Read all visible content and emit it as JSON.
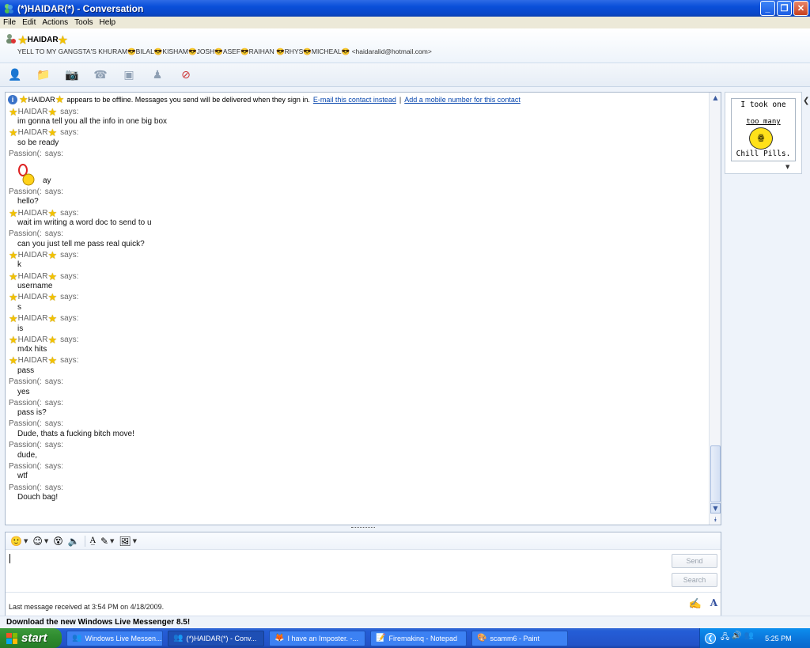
{
  "window": {
    "title": "(*)HAIDAR(*) - Conversation"
  },
  "menu": [
    "File",
    "Edit",
    "Actions",
    "Tools",
    "Help"
  ],
  "contact": {
    "name": "HAIDAR",
    "personal_message": "YELL TO MY GANGSTA'S KHURAM😎BILAL😎KISHAM😎JOSH😎ASEF😎RAIHAN 😎RHYS😎MICHEAL😎 <haidaralid@hotmail.com>"
  },
  "infobar": {
    "name": "HAIDAR",
    "text": "appears to be offline. Messages you send will be delivered when they sign in.",
    "link1": "E-mail this contact instead",
    "separator": "|",
    "link2": "Add a mobile number for this contact"
  },
  "says_label": "says:",
  "messages": [
    {
      "from": "HAIDAR",
      "star": true,
      "text": "im gonna tell you all the info in one big box"
    },
    {
      "from": "HAIDAR",
      "star": true,
      "text": "so be ready"
    },
    {
      "from": "Passion(:",
      "star": false,
      "text": "ay",
      "emoticon": true
    },
    {
      "from": "Passion(:",
      "star": false,
      "text": "hello?"
    },
    {
      "from": "HAIDAR",
      "star": true,
      "text": "wait im writing a word doc to send to u"
    },
    {
      "from": "Passion(:",
      "star": false,
      "text": "can you just tell me pass real quick?"
    },
    {
      "from": "HAIDAR",
      "star": true,
      "text": "k"
    },
    {
      "from": "HAIDAR",
      "star": true,
      "text": "username"
    },
    {
      "from": "HAIDAR",
      "star": true,
      "text": "s"
    },
    {
      "from": "HAIDAR",
      "star": true,
      "text": "is"
    },
    {
      "from": "HAIDAR",
      "star": true,
      "text": "m4x hits"
    },
    {
      "from": "HAIDAR",
      "star": true,
      "text": "pass"
    },
    {
      "from": "Passion(:",
      "star": false,
      "text": "yes"
    },
    {
      "from": "Passion(:",
      "star": false,
      "text": "pass is?"
    },
    {
      "from": "Passion(:",
      "star": false,
      "text": "Dude, thats a fucking bitch move!"
    },
    {
      "from": "Passion(:",
      "star": false,
      "text": "dude,"
    },
    {
      "from": "Passion(:",
      "star": false,
      "text": "wtf"
    },
    {
      "from": "Passion(:",
      "star": false,
      "text": "Douch bag!"
    }
  ],
  "input": {
    "send_label": "Send",
    "search_label": "Search",
    "status": "Last message received at 3:54 PM on 4/18/2009."
  },
  "display_picture": {
    "line1": "I took one",
    "line2": "too many",
    "line3": "Chill Pills."
  },
  "banner": "Download the new Windows Live Messenger 8.5!",
  "taskbar": {
    "start_label": "start",
    "tasks": [
      {
        "label": "Windows Live Messen...",
        "icon": "messenger-icon",
        "active": false
      },
      {
        "label": "(*)HAIDAR(*) - Conv...",
        "icon": "conversation-icon",
        "active": true
      },
      {
        "label": "I have an Imposter. -...",
        "icon": "firefox-icon",
        "active": false
      },
      {
        "label": "Firemakinq - Notepad",
        "icon": "notepad-icon",
        "active": false
      },
      {
        "label": "scamm6 - Paint",
        "icon": "paint-icon",
        "active": false
      }
    ],
    "clock": "5:25 PM"
  }
}
